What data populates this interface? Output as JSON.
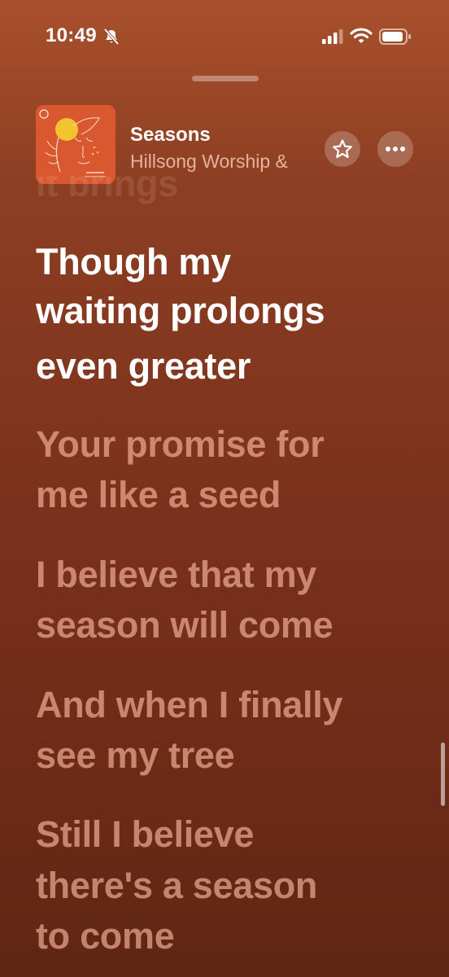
{
  "status_bar": {
    "time": "10:49",
    "icons": [
      "bell-slash-icon",
      "cellular-signal-icon",
      "wifi-icon",
      "battery-icon"
    ]
  },
  "now_playing": {
    "title": "Seasons",
    "artist": "Hillsong Worship &",
    "actions": [
      "star-icon",
      "more-icon"
    ]
  },
  "lyrics": {
    "previous": "it brings",
    "active": [
      "Though my",
      "waiting prolongs",
      "even greater"
    ],
    "upcoming": [
      [
        "Your promise for",
        "me like a seed"
      ],
      [
        "I believe that my",
        "season will come"
      ],
      [
        "And when I finally",
        "see my tree"
      ],
      [
        "Still I believe",
        "there's a season",
        "to come"
      ]
    ]
  },
  "colors": {
    "background_top": "#a9502c",
    "background_bottom": "#5f2614",
    "active_lyric": "#ffffff",
    "upcoming_lyric": "#e0a58c"
  }
}
